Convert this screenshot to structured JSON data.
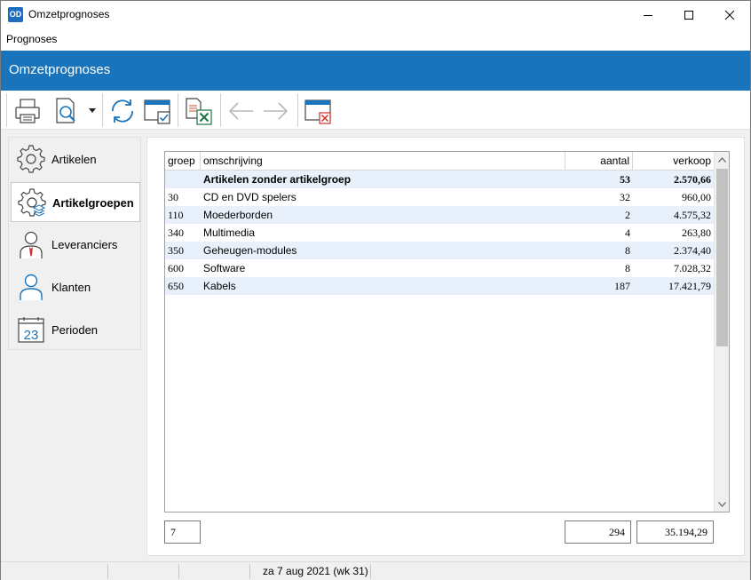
{
  "window": {
    "app_icon_text": "OD",
    "title": "Omzetprognoses"
  },
  "menu": {
    "items": [
      "Prognoses"
    ]
  },
  "header": {
    "title": "Omzetprognoses"
  },
  "toolbar": {
    "buttons": [
      "print-icon",
      "print-preview-icon",
      "refresh-icon",
      "select-window-icon",
      "export-excel-icon",
      "back-arrow-icon",
      "forward-arrow-icon",
      "close-window-icon"
    ]
  },
  "sidebar": {
    "items": [
      {
        "label": "Artikelen",
        "icon": "gear-icon",
        "active": false
      },
      {
        "label": "Artikelgroepen",
        "icon": "gear-stack-icon",
        "active": true
      },
      {
        "label": "Leveranciers",
        "icon": "supplier-person-icon",
        "active": false
      },
      {
        "label": "Klanten",
        "icon": "customer-person-icon",
        "active": false
      },
      {
        "label": "Perioden",
        "icon": "calendar-icon",
        "active": false,
        "icon_text": "23"
      }
    ]
  },
  "grid": {
    "columns": [
      "groep",
      "omschrijving",
      "aantal",
      "verkoop"
    ],
    "rows": [
      {
        "groep": "",
        "omschrijving": "Artikelen zonder artikelgroep",
        "aantal": "53",
        "verkoop": "2.570,66",
        "bold": true
      },
      {
        "groep": "30",
        "omschrijving": "CD en DVD spelers",
        "aantal": "32",
        "verkoop": "960,00"
      },
      {
        "groep": "110",
        "omschrijving": "Moederborden",
        "aantal": "2",
        "verkoop": "4.575,32"
      },
      {
        "groep": "340",
        "omschrijving": "Multimedia",
        "aantal": "4",
        "verkoop": "263,80"
      },
      {
        "groep": "350",
        "omschrijving": "Geheugen-modules",
        "aantal": "8",
        "verkoop": "2.374,40"
      },
      {
        "groep": "600",
        "omschrijving": "Software",
        "aantal": "8",
        "verkoop": "7.028,32"
      },
      {
        "groep": "650",
        "omschrijving": "Kabels",
        "aantal": "187",
        "verkoop": "17.421,79"
      }
    ]
  },
  "totals": {
    "count": "7",
    "aantal": "294",
    "verkoop": "35.194,29"
  },
  "status": {
    "date": "za 7 aug 2021 (wk 31)"
  },
  "colors": {
    "accent": "#1a74bc",
    "row_alt": "#e8f1fb"
  }
}
